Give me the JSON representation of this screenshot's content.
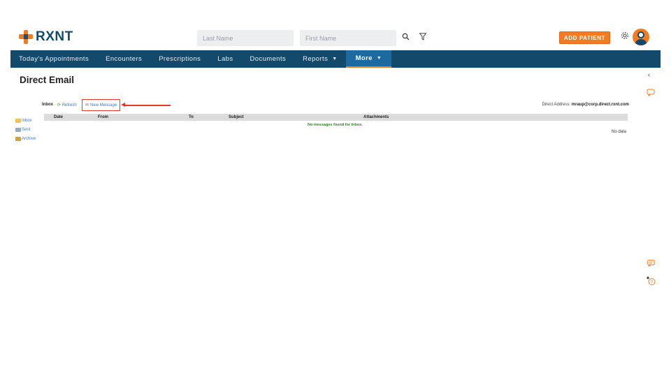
{
  "brand": {
    "name": "RXNT"
  },
  "header": {
    "last_name_placeholder": "Last Name",
    "first_name_placeholder": "First Name",
    "add_patient_label": "ADD PATIENT"
  },
  "nav": {
    "items": [
      {
        "label": "Today's Appointments"
      },
      {
        "label": "Encounters"
      },
      {
        "label": "Prescriptions"
      },
      {
        "label": "Labs"
      },
      {
        "label": "Documents"
      },
      {
        "label": "Reports"
      },
      {
        "label": "More"
      }
    ]
  },
  "page": {
    "title": "Direct Email"
  },
  "toolbar": {
    "inbox_label": "Inbox",
    "refresh_label": "Refresh",
    "new_message_label": "New Message",
    "address_label": "Direct Address:",
    "address_value": "mraup@corp.direct.rxnt.com"
  },
  "folders": [
    {
      "label": "Inbox"
    },
    {
      "label": "Sent"
    },
    {
      "label": "Archive"
    }
  ],
  "table": {
    "columns": [
      "Date",
      "From",
      "To",
      "Subject",
      "Attachments"
    ],
    "empty_message": "No messages found for Inbox.",
    "no_data": "No data"
  },
  "colors": {
    "primary": "#134a6b",
    "accent": "#f47b20",
    "link": "#3a7bd5",
    "success": "#2e8b1f",
    "highlight": "#e03a2f"
  }
}
